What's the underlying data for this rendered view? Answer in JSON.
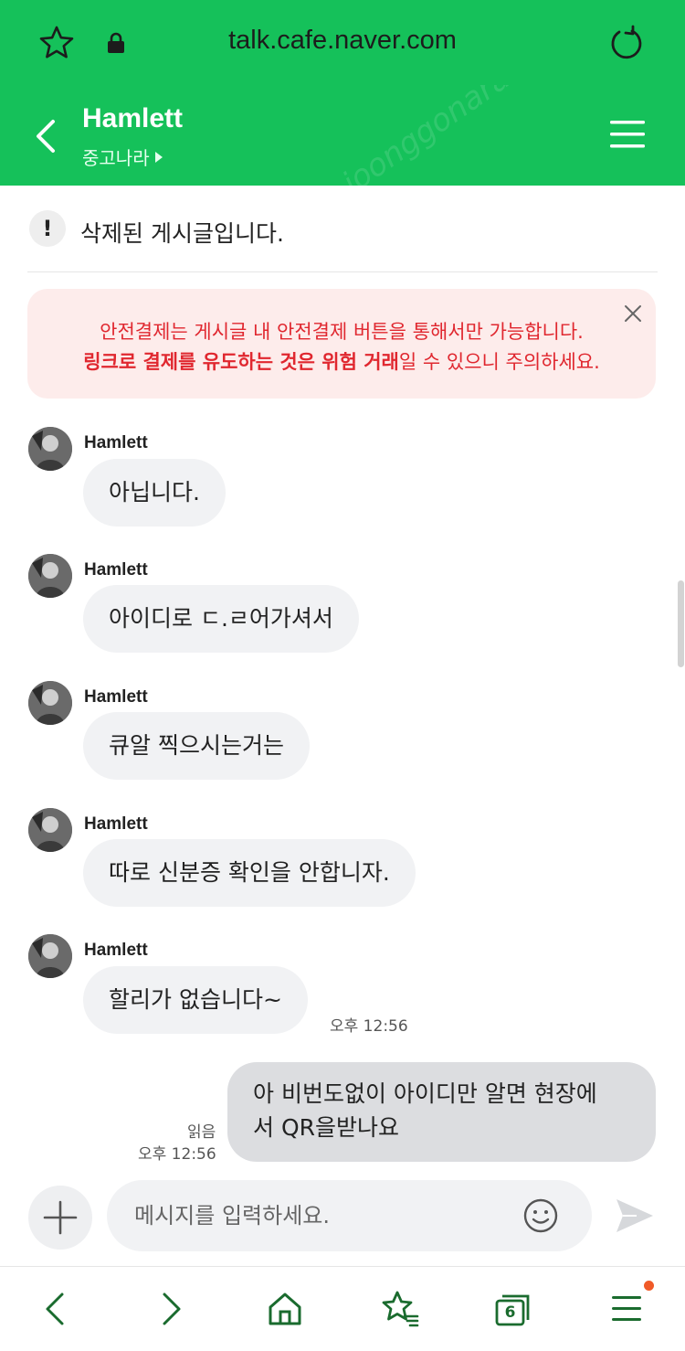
{
  "browser": {
    "url": "talk.cafe.naver.com",
    "tab_count": "6"
  },
  "header": {
    "title": "Hamlett",
    "subtitle": "중고나라",
    "watermark": "joonggonara",
    "color": "#15c15a"
  },
  "notice": {
    "deleted_text": "삭제된 게시글입니다."
  },
  "warning": {
    "line1": "안전결제는 게시글 내 안전결제 버튼을 통해서만 가능합니다.",
    "line2_bold": "링크로 결제를 유도하는 것은 위험 거래",
    "line2_rest": "일 수 있으니 주의하세요.",
    "color": "#e0272f"
  },
  "messages": [
    {
      "sender": "Hamlett",
      "text": "아닙니다."
    },
    {
      "sender": "Hamlett",
      "text": "아이디로 ㄷ.ㄹ어가셔서"
    },
    {
      "sender": "Hamlett",
      "text": "큐알 찍으시는거는"
    },
    {
      "sender": "Hamlett",
      "text": "따로 신분증 확인을 안합니자."
    },
    {
      "sender": "Hamlett",
      "text": "할리가 없습니다~",
      "time": "오후 12:56"
    }
  ],
  "my_message": {
    "line1": "아 비번도없이 아이디만 알면 현장에",
    "line2": "서 QR을받나요",
    "read": "읽음",
    "time": "오후 12:56"
  },
  "composer": {
    "placeholder": "메시지를 입력하세요."
  }
}
